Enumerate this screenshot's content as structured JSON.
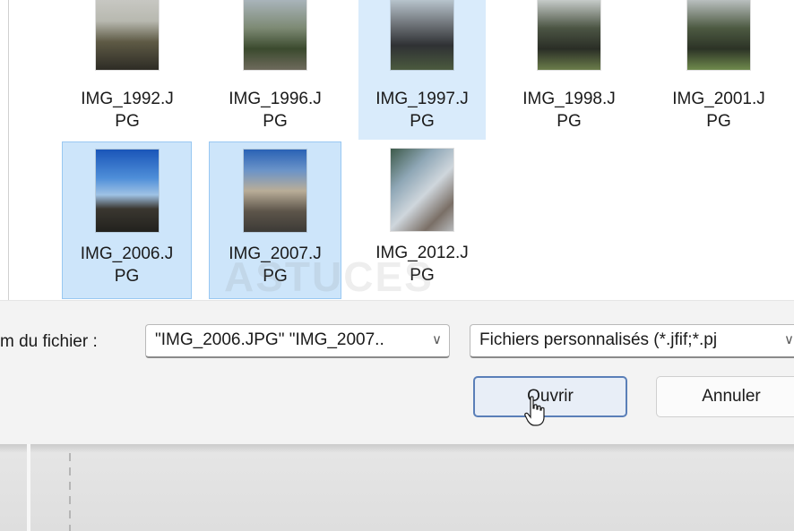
{
  "files": [
    {
      "name_line1": "IMG_1992.J",
      "name_line2": "PG"
    },
    {
      "name_line1": "IMG_1996.J",
      "name_line2": "PG"
    },
    {
      "name_line1": "IMG_1997.J",
      "name_line2": "PG"
    },
    {
      "name_line1": "IMG_1998.J",
      "name_line2": "PG"
    },
    {
      "name_line1": "IMG_2001.J",
      "name_line2": "PG"
    },
    {
      "name_line1": "IMG_2006.J",
      "name_line2": "PG"
    },
    {
      "name_line1": "IMG_2007.J",
      "name_line2": "PG"
    },
    {
      "name_line1": "IMG_2012.J",
      "name_line2": "PG"
    }
  ],
  "filename_label": "m du fichier :",
  "filename_value": "\"IMG_2006.JPG\" \"IMG_2007..",
  "filter_value": "Fichiers personnalisés (*.jfif;*.pj",
  "buttons": {
    "open": "Ouvrir",
    "cancel": "Annuler"
  },
  "watermark": "ASTUCES",
  "colors": {
    "selection": "#cde5fa",
    "selection_border": "#99c8f2",
    "primary_border": "#5a7fb8"
  }
}
